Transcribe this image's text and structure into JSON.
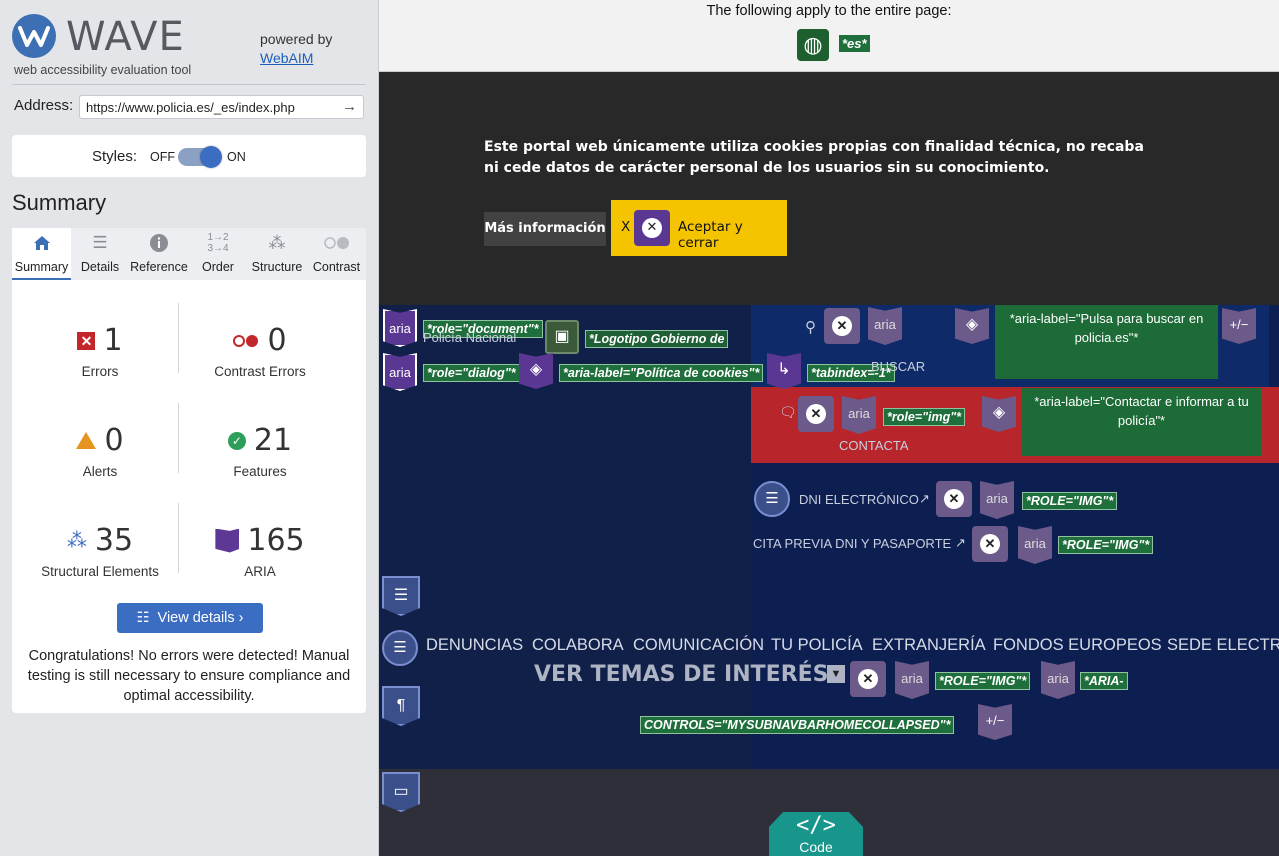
{
  "sidebar": {
    "logo_title": "WAVE",
    "logo_subtitle": "web accessibility evaluation tool",
    "powered_by": "powered by",
    "webaim_link": "WebAIM",
    "address_label": "Address:",
    "address_value": "https://www.policia.es/_es/index.php",
    "styles_label": "Styles:",
    "styles_off": "OFF",
    "styles_on": "ON",
    "summary_title": "Summary",
    "tabs": [
      {
        "label": "Summary",
        "icon": "home-icon"
      },
      {
        "label": "Details",
        "icon": "list-icon"
      },
      {
        "label": "Reference",
        "icon": "info-icon"
      },
      {
        "label": "Order",
        "icon": "order-icon"
      },
      {
        "label": "Structure",
        "icon": "structure-icon"
      },
      {
        "label": "Contrast",
        "icon": "contrast-icon"
      }
    ],
    "stats": {
      "errors": {
        "value": "1",
        "label": "Errors"
      },
      "contrast_errors": {
        "value": "0",
        "label": "Contrast Errors"
      },
      "alerts": {
        "value": "0",
        "label": "Alerts"
      },
      "features": {
        "value": "21",
        "label": "Features"
      },
      "structural": {
        "value": "35",
        "label": "Structural Elements"
      },
      "aria": {
        "value": "165",
        "label": "ARIA"
      }
    },
    "view_details": "View details ›",
    "congrats": "Congratulations! No errors were detected! Manual testing is still necessary to ensure compliance and optimal accessibility."
  },
  "main": {
    "page_note": "The following apply to the entire page:",
    "lang_tag": "*es*",
    "cookie_text": "Este portal web únicamente utiliza cookies propias con finalidad técnica, no recaba ni cede datos de carácter personal de los usuarios sin su conocimiento.",
    "mas_info": "Más información",
    "accept_x": "X",
    "accept_label": "Aceptar y cerrar",
    "aria_text": "aria",
    "tags": {
      "role_document": "*role=\"document\"*",
      "policia_nacional": "Policía Nacional",
      "logo_alt": "*Logotipo Gobierno de",
      "role_dialog": "*role=\"dialog\"*",
      "aria_label_cookies": "*aria-label=\"Política de cookies\"*",
      "tabindex": "*tabindex=-1*",
      "aria_label_buscar": "*aria-label=\"Pulsa para buscar en policia.es\"*",
      "buscar": "BUSCAR",
      "role_img": "*role=\"img\"*",
      "aria_label_contactar": "*aria-label=\"Contactar e informar a tu policía\"*",
      "contacta": "CONTACTA",
      "dni": "DNI ELECTRÓNICO",
      "ROLE_IMG": "*ROLE=\"IMG\"*",
      "cita": "CITA PREVIA DNI Y PASAPORTE",
      "aria_controls_1": "*ARIA-",
      "aria_controls_2": "CONTROLS=\"MYSUBNAVBARHOMECOLLAPSED\"*",
      "plus_minus": "+/−"
    },
    "nav": [
      "DENUNCIAS",
      "COLABORA",
      "COMUNICACIÓN",
      "TU POLICÍA",
      "EXTRANJERÍA",
      "FONDOS EUROPEOS",
      "SEDE ELECTRO"
    ],
    "ver_temas": "VER TEMAS DE INTERÉS",
    "code_label": "Code",
    "code_tag": "</>"
  },
  "colors": {
    "wave_blue": "#3d6fb5",
    "error_red": "#c3272b",
    "aria_purple": "#5b3794",
    "feature_green": "#1e6f3b",
    "cookie_yellow": "#f5c400"
  }
}
